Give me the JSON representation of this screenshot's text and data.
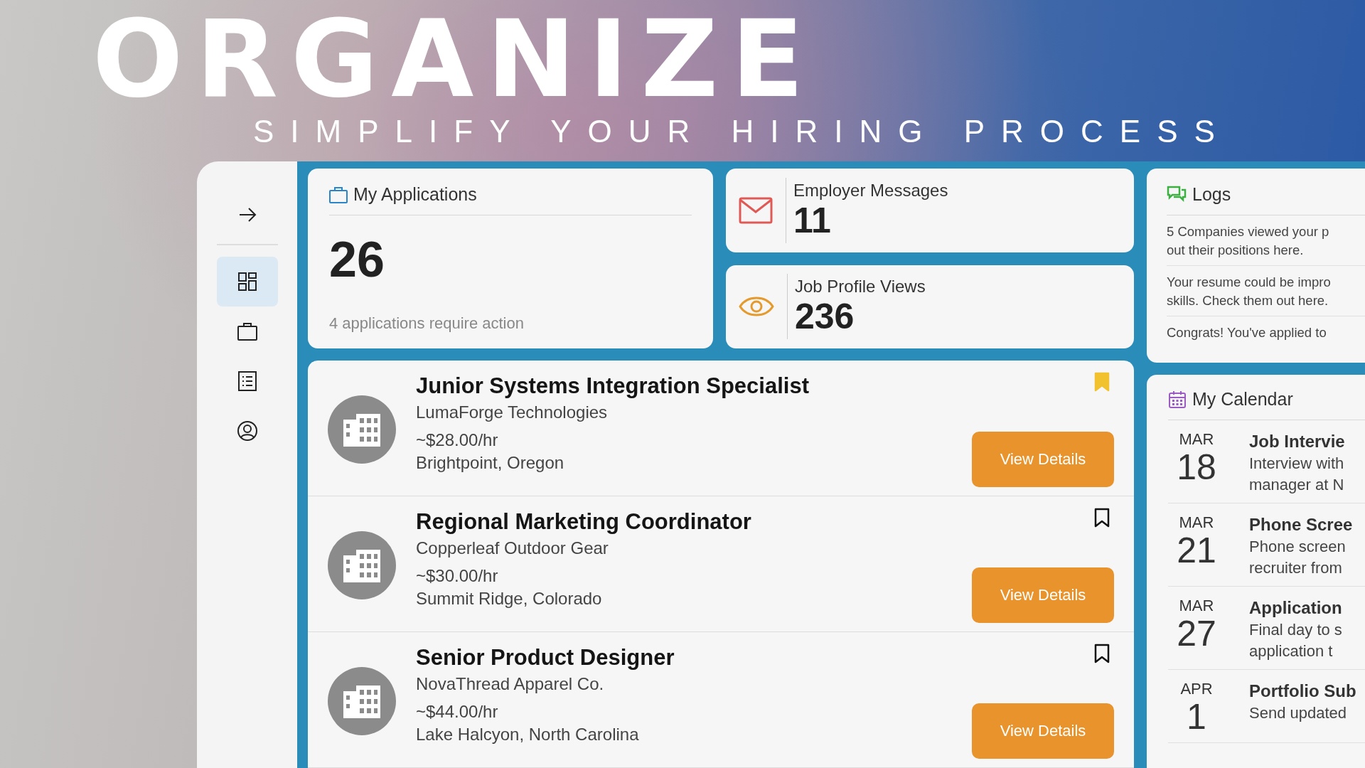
{
  "headline": "ORGANIZE",
  "tagline": "SIMPLIFY YOUR HIRING PROCESS",
  "sidebar": {
    "items": [
      {
        "kind": "dashboard",
        "selected": true
      },
      {
        "kind": "briefcase",
        "selected": false
      },
      {
        "kind": "list",
        "selected": false
      },
      {
        "kind": "profile",
        "selected": false
      }
    ]
  },
  "applications": {
    "title": "My Applications",
    "count": "26",
    "action": "4 applications require action"
  },
  "stats": [
    {
      "kind": "mail",
      "label": "Employer Messages",
      "value": "11"
    },
    {
      "kind": "eye",
      "label": "Job Profile Views",
      "value": "236"
    }
  ],
  "logs": {
    "title": "Logs",
    "entries": [
      {
        "lines": [
          "5 Companies viewed your p",
          "out their positions here."
        ]
      },
      {
        "lines": [
          "Your resume could be impro",
          "skills. Check them out here."
        ]
      },
      {
        "lines": [
          "Congrats! You've applied to"
        ]
      }
    ]
  },
  "jobs": [
    {
      "title": "Junior Systems Integration Specialist",
      "company": "LumaForge Technologies",
      "pay": "~$28.00/hr",
      "location": "Brightpoint, Oregon",
      "bookmarked": true,
      "button": "View Details"
    },
    {
      "title": "Regional Marketing Coordinator",
      "company": "Copperleaf Outdoor Gear",
      "pay": "~$30.00/hr",
      "location": "Summit Ridge, Colorado",
      "bookmarked": false,
      "button": "View Details"
    },
    {
      "title": "Senior Product Designer",
      "company": "NovaThread Apparel Co.",
      "pay": "~$44.00/hr",
      "location": "Lake Halcyon, North Carolina",
      "bookmarked": false,
      "button": "View Details"
    }
  ],
  "calendar": {
    "title": "My Calendar",
    "events": [
      {
        "month": "MAR",
        "day": "18",
        "title": "Job Intervie",
        "lines": [
          "Interview with",
          "manager at N"
        ]
      },
      {
        "month": "MAR",
        "day": "21",
        "title": "Phone Scree",
        "lines": [
          "Phone screen",
          "recruiter from"
        ]
      },
      {
        "month": "MAR",
        "day": "27",
        "title": "Application",
        "lines": [
          "Final day to s",
          "application t"
        ]
      },
      {
        "month": "APR",
        "day": "1",
        "title": "Portfolio Sub",
        "lines": [
          "Send updated"
        ]
      }
    ]
  }
}
